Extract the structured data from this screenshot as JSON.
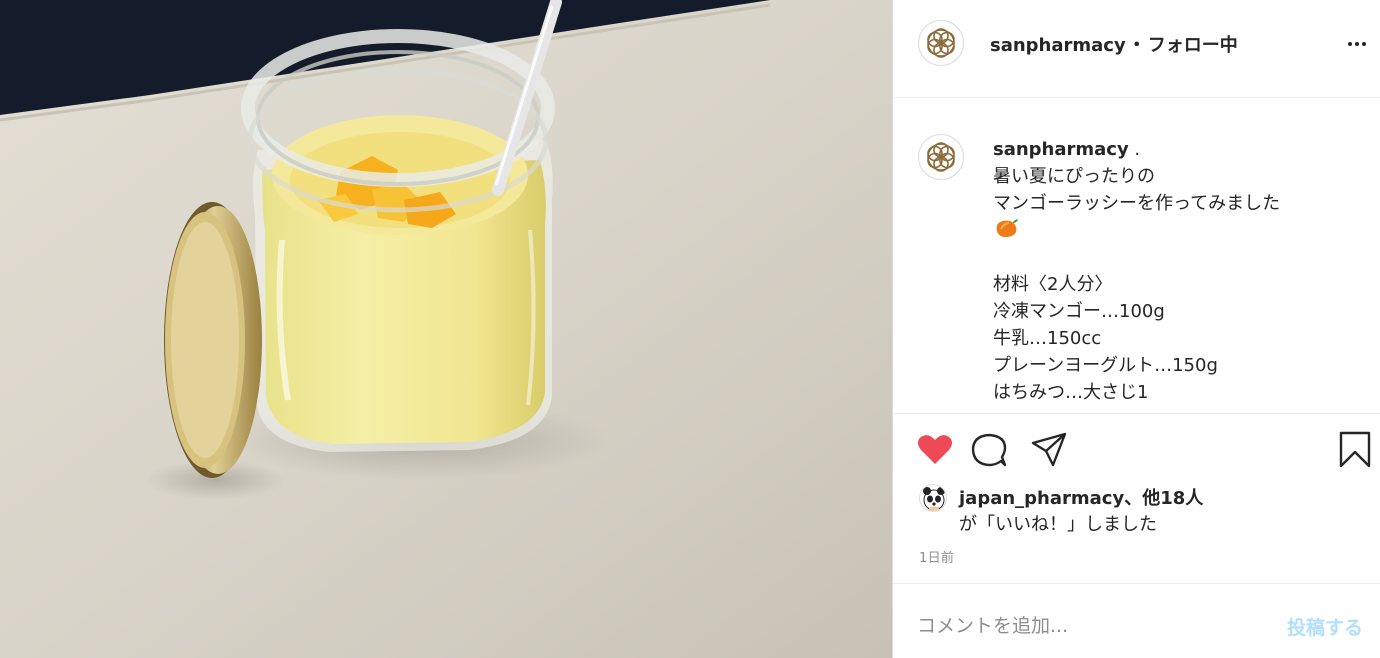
{
  "post": {
    "image_description_icon": "photo-mango-lassi",
    "colors": {
      "heart": "#ed4956",
      "text": "#262626",
      "muted": "#8e8e8e",
      "post_button_disabled": "#b2dffc",
      "logo_brown": "#8a6b3a"
    }
  },
  "header": {
    "username": "sanpharmacy",
    "separator": "・",
    "follow_status": "フォロー中",
    "more_icon": "more-horizontal-icon"
  },
  "caption": {
    "username": "sanpharmacy",
    "first_line_suffix": " .",
    "lines_a": [
      "暑い夏にぴったりの",
      "マンゴーラッシーを作ってみました"
    ],
    "emoji": "mango-emoji",
    "lines_b": [
      "材料〈2人分〉",
      "冷凍マンゴー…100g",
      "牛乳…150cc",
      "プレーンヨーグルト…150g",
      "はちみつ…大さじ1"
    ]
  },
  "actions": {
    "like_icon": "heart-filled-icon",
    "comment_icon": "comment-icon",
    "share_icon": "share-icon",
    "save_icon": "bookmark-icon"
  },
  "likes": {
    "liker": "japan_pharmacy",
    "others": "、他18人",
    "suffix": "が「いいね！」しました"
  },
  "time": "1日前",
  "comment": {
    "placeholder": "コメントを追加...",
    "post_label": "投稿する"
  }
}
